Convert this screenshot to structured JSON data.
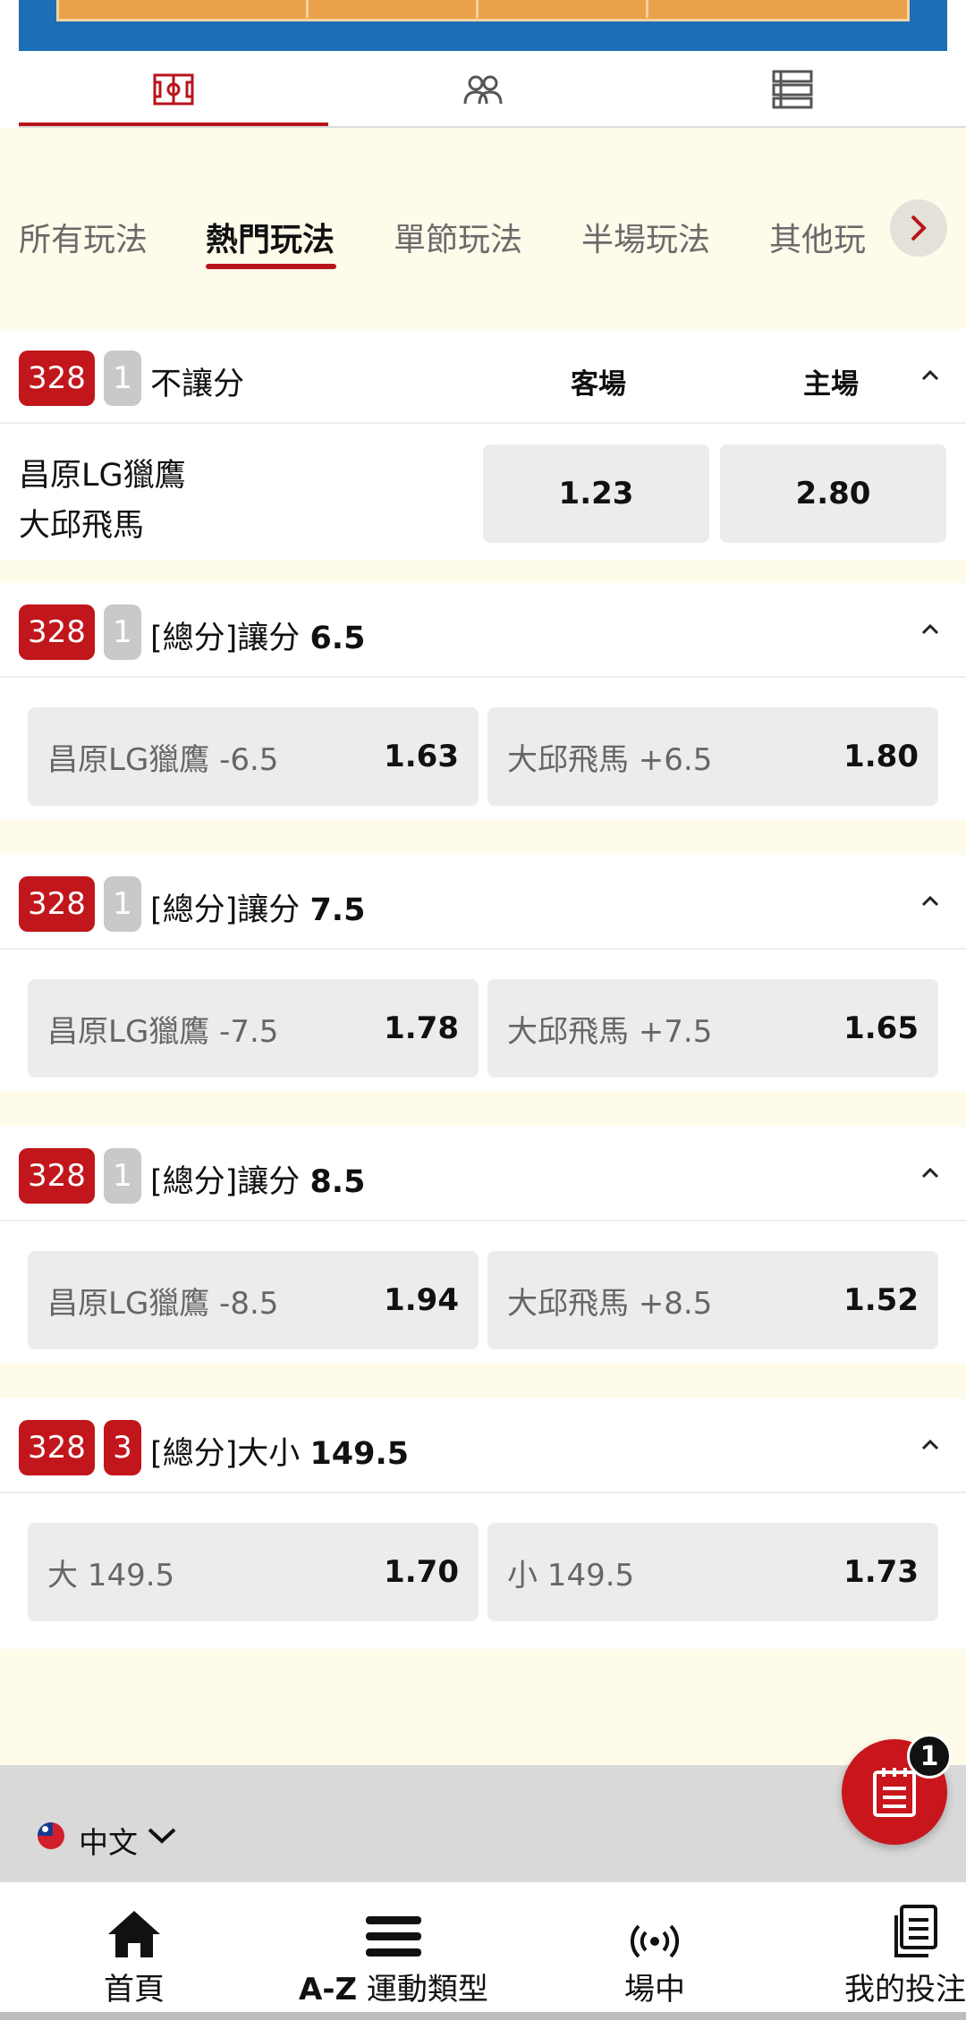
{
  "icon_tabs": [
    {
      "icon": "basketball-court-icon",
      "active": true
    },
    {
      "icon": "players-icon",
      "active": false
    },
    {
      "icon": "list-rows-icon",
      "active": false
    }
  ],
  "category_tabs": {
    "items": [
      "所有玩法",
      "熱門玩法",
      "單節玩法",
      "半場玩法",
      "其他玩"
    ],
    "active_index": 1
  },
  "markets": [
    {
      "code": "328",
      "period": "1",
      "title": "不讓分",
      "col_away": "客場",
      "col_home": "主場",
      "team_away": "昌原LG獵鷹",
      "team_home": "大邱飛馬",
      "odds_away": "1.23",
      "odds_home": "2.80"
    },
    {
      "code": "328",
      "period": "1",
      "title_prefix": "[總分]讓分",
      "title_value": "6.5",
      "left_label": "昌原LG獵鷹 -6.5",
      "left_odds": "1.63",
      "right_label": "大邱飛馬 +6.5",
      "right_odds": "1.80"
    },
    {
      "code": "328",
      "period": "1",
      "title_prefix": "[總分]讓分",
      "title_value": "7.5",
      "left_label": "昌原LG獵鷹 -7.5",
      "left_odds": "1.78",
      "right_label": "大邱飛馬 +7.5",
      "right_odds": "1.65"
    },
    {
      "code": "328",
      "period": "1",
      "title_prefix": "[總分]讓分",
      "title_value": "8.5",
      "left_label": "昌原LG獵鷹 -8.5",
      "left_odds": "1.94",
      "right_label": "大邱飛馬 +8.5",
      "right_odds": "1.52"
    },
    {
      "code": "328",
      "period": "3",
      "title_prefix": "[總分]大小",
      "title_value": "149.5",
      "left_label": "大 149.5",
      "left_odds": "1.70",
      "right_label": "小 149.5",
      "right_odds": "1.73"
    }
  ],
  "language": {
    "flag": "taiwan-flag-icon",
    "label": "中文"
  },
  "bet_slip": {
    "count": "1"
  },
  "bottom_nav": [
    {
      "icon": "home-icon",
      "label": "首頁"
    },
    {
      "icon": "menu-icon",
      "label_bold": "A-Z",
      "label": " 運動類型"
    },
    {
      "icon": "live-broadcast-icon",
      "label": "場中"
    },
    {
      "icon": "my-bets-icon",
      "label": "我的投注"
    }
  ],
  "colors": {
    "accent": "#b8141b",
    "badge_red": "#c0161c",
    "badge_grey": "#c9c9c9",
    "page_bg": "#fffbeb",
    "odds_box": "#ececec"
  }
}
